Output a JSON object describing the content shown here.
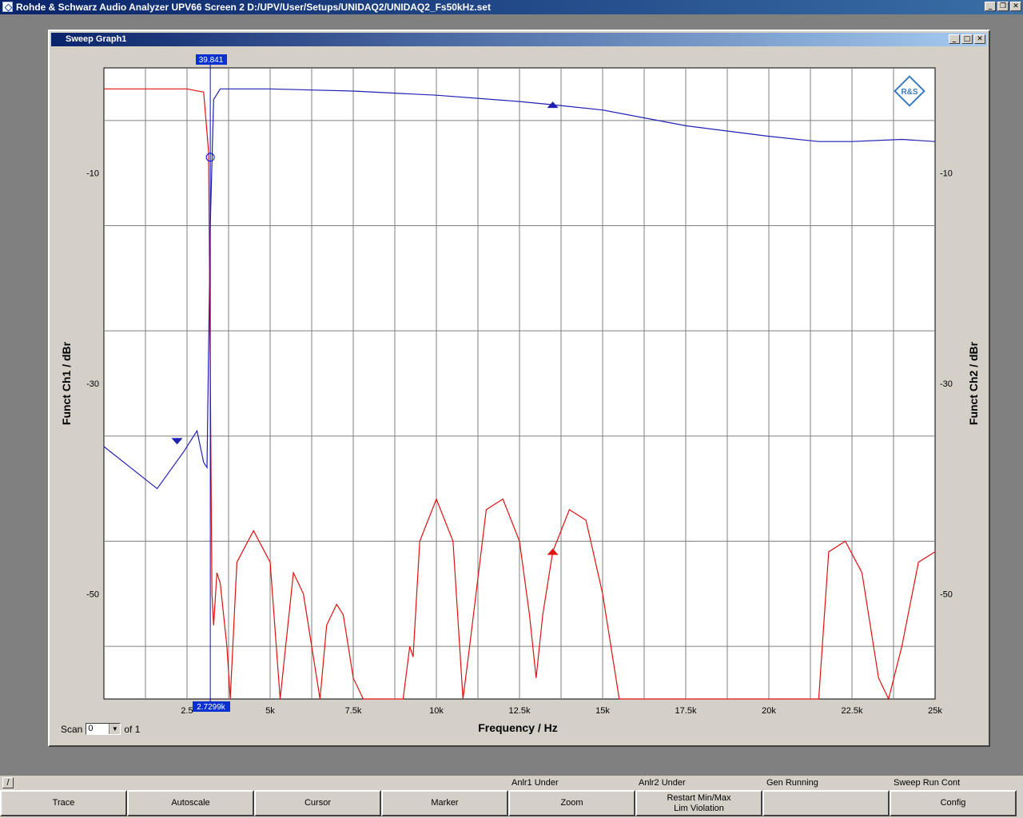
{
  "window": {
    "title": "Rohde & Schwarz Audio Analyzer UPV66 Screen 2 D:/UPV/User/Setups/UNIDAQ2/UNIDAQ2_Fs50kHz.set",
    "minimize": "_",
    "restore": "❐",
    "close": "✕"
  },
  "subwindow": {
    "title": "Sweep Graph1",
    "minimize": "_",
    "maximize": "□",
    "close": "✕"
  },
  "colors": {
    "trace_ch1": "#1f1fb4",
    "trace_ch2": "#e01010",
    "cursor_marker": "#0000ff",
    "grid": "#808080",
    "plot_bg": "#ffffff"
  },
  "chart_data": {
    "type": "line",
    "xlabel": "Frequency / Hz",
    "ylabel_left": "Funct Ch1 / dBr",
    "ylabel_right": "Funct Ch2 / dBr",
    "xlim": [
      0,
      25000
    ],
    "ylim": [
      -60,
      0
    ],
    "x_tick_labels": [
      "2.5",
      "5k",
      "7.5k",
      "10k",
      "12.5k",
      "15k",
      "17.5k",
      "20k",
      "22.5k",
      "25k"
    ],
    "y_tick_labels": [
      "-10",
      "-30",
      "-50"
    ],
    "y_ticks": [
      -10,
      -30,
      -50
    ],
    "grid": true,
    "cursor_top_readout": "39.841",
    "cursor_bottom_readout": "2.7299k",
    "cursor_x": 3200,
    "logo": "R&S",
    "series": [
      {
        "x": [
          0,
          800,
          1600,
          2400,
          2800,
          3000,
          3100,
          3200,
          3300,
          3500,
          4000,
          5000,
          7500,
          10000,
          12500,
          13500,
          15000,
          17500,
          20000,
          21500,
          22500,
          24000,
          25000
        ],
        "y": [
          -36,
          -38,
          -40,
          -36.5,
          -34.5,
          -37.5,
          -38,
          -15,
          -3,
          -2,
          -2,
          -2,
          -2.2,
          -2.6,
          -3.2,
          -3.5,
          -4,
          -5.5,
          -6.5,
          -7,
          -7,
          -6.8,
          -7
        ]
      },
      {
        "x": [
          0,
          2500,
          3000,
          3150,
          3250,
          3300,
          3400,
          3500,
          3700,
          3800,
          4000,
          4500,
          5000,
          5300,
          5700,
          6000,
          6500,
          6700,
          7000,
          7200,
          7500,
          7800,
          8000,
          8500,
          9000,
          9200,
          9300,
          9500,
          10000,
          10500,
          10800,
          11000,
          11500,
          12000,
          12500,
          12800,
          13000,
          13200,
          13500,
          14000,
          14500,
          15000,
          15500,
          15700,
          16000,
          18000,
          20000,
          21500,
          21800,
          22300,
          22800,
          23300,
          23600,
          24000,
          24500,
          25000
        ],
        "y": [
          -2,
          -2,
          -2.3,
          -8,
          -50,
          -53,
          -48,
          -49,
          -55,
          -62,
          -47,
          -44,
          -47,
          -62,
          -48,
          -50,
          -63,
          -53,
          -51,
          -52,
          -58,
          -64,
          -64,
          -62,
          -64,
          -55,
          -56,
          -45,
          -41,
          -45,
          -62,
          -55,
          -42,
          -41,
          -45,
          -52,
          -58,
          -52,
          -46,
          -42,
          -43,
          -50,
          -60,
          -64,
          -64,
          -64,
          -64,
          -64,
          -46,
          -45,
          -48,
          -58,
          -64,
          -55,
          -47,
          -46
        ]
      }
    ]
  },
  "scan": {
    "label": "Scan",
    "value": "0",
    "of_label": "of 1"
  },
  "status": {
    "slash": "/",
    "items": [
      "Anlr1 Under",
      "Anlr2 Under",
      "Gen Running",
      "Sweep Run Cont"
    ]
  },
  "softkeys": [
    {
      "label": "Trace"
    },
    {
      "label": "Autoscale"
    },
    {
      "label": "Cursor"
    },
    {
      "label": "Marker"
    },
    {
      "label": "Zoom"
    },
    {
      "label": "Restart Min/Max",
      "label2": "Lim Violation"
    },
    {
      "label": ""
    },
    {
      "label": "Config"
    }
  ]
}
